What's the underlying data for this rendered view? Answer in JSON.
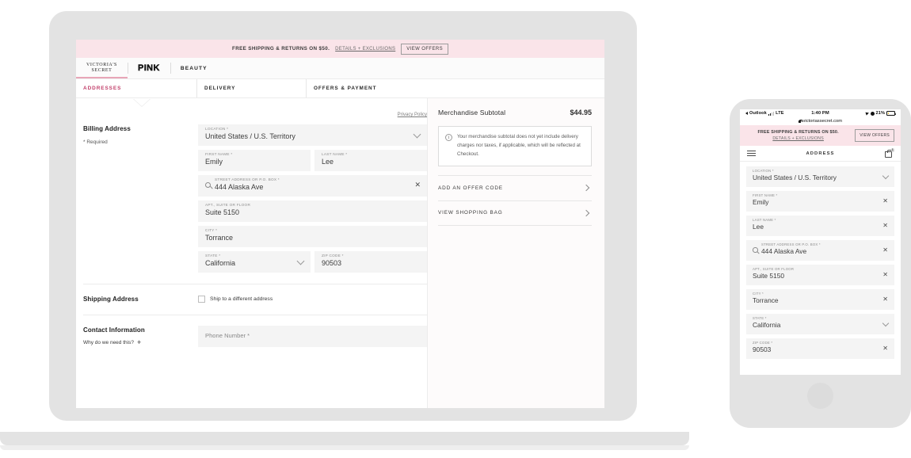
{
  "promo": {
    "text": "FREE SHIPPING & RETURNS ON $50.",
    "link": "DETAILS + EXCLUSIONS",
    "button": "VIEW OFFERS"
  },
  "brand": {
    "vs_line1": "VICTORIA'S",
    "vs_line2": "SECRET",
    "pink": "PINK",
    "beauty": "BEAUTY"
  },
  "steps": [
    {
      "label": "ADDRESSES"
    },
    {
      "label": "DELIVERY"
    },
    {
      "label": "OFFERS & PAYMENT"
    }
  ],
  "billing": {
    "title": "Billing Address",
    "required_note": "* Required",
    "privacy_link": "Privacy Policy",
    "fields": {
      "location": {
        "label": "LOCATION *",
        "value": "United States / U.S. Territory"
      },
      "first_name": {
        "label": "FIRST NAME *",
        "value": "Emily"
      },
      "last_name": {
        "label": "LAST NAME *",
        "value": "Lee"
      },
      "street": {
        "label": "STREET ADDRESS OR P.O. BOX *",
        "value": "444 Alaska Ave"
      },
      "apt": {
        "label": "APT., SUITE OR FLOOR",
        "value": "Suite 5150"
      },
      "city": {
        "label": "CITY *",
        "value": "Torrance"
      },
      "state": {
        "label": "STATE *",
        "value": "California"
      },
      "zip": {
        "label": "ZIP CODE *",
        "value": "90503"
      }
    }
  },
  "shipping": {
    "title": "Shipping Address",
    "checkbox_label": "Ship to a different address"
  },
  "contact": {
    "title": "Contact Information",
    "help_text": "Why do we need this?",
    "phone_placeholder": "Phone Number *"
  },
  "summary": {
    "subtotal_label": "Merchandise Subtotal",
    "subtotal_value": "$44.95",
    "notice": "Your merchandise subtotal does not yet include delivery charges nor taxes, if applicable, which will be reflected at Checkout.",
    "rows": [
      {
        "label": "ADD AN OFFER CODE"
      },
      {
        "label": "VIEW SHOPPING BAG"
      }
    ]
  },
  "phone": {
    "status": {
      "carrier": "Outlook",
      "network": "LTE",
      "time": "1:40 PM",
      "battery": "21%"
    },
    "url": "victoriassecret.com",
    "promo": {
      "text": "FREE SHIPPING & RETURNS ON $50.",
      "link": "DETAILS + EXCLUSIONS",
      "button": "VIEW OFFERS"
    },
    "header": {
      "title": "ADDRESS",
      "bag_count": "1"
    },
    "fields": [
      {
        "label": "LOCATION *",
        "value": "United States / U.S. Territory",
        "control": "chevron",
        "search": false
      },
      {
        "label": "FIRST NAME *",
        "value": "Emily",
        "control": "clear",
        "search": false
      },
      {
        "label": "LAST NAME *",
        "value": "Lee",
        "control": "clear",
        "search": false
      },
      {
        "label": "STREET ADDRESS OR P.O. BOX *",
        "value": "444 Alaska Ave",
        "control": "clear",
        "search": true
      },
      {
        "label": "APT., SUITE OR FLOOR",
        "value": "Suite 5150",
        "control": "clear",
        "search": false
      },
      {
        "label": "CITY *",
        "value": "Torrance",
        "control": "clear",
        "search": false
      },
      {
        "label": "STATE *",
        "value": "California",
        "control": "chevron",
        "search": false
      },
      {
        "label": "ZIP CODE *",
        "value": "90503",
        "control": "clear",
        "search": false
      }
    ]
  },
  "colors": {
    "accent_pink": "#c2406b",
    "banner_pink": "#fae4e9",
    "device_gray": "#e3e3e3",
    "field_gray": "#f4f4f4"
  }
}
